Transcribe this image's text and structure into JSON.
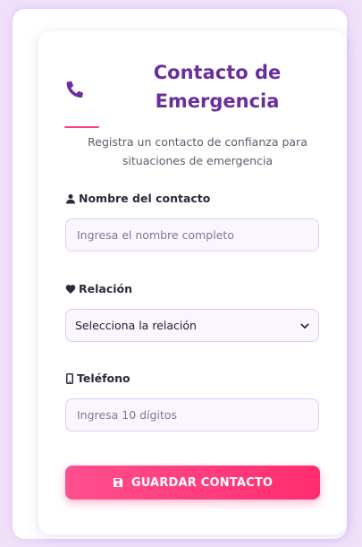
{
  "header": {
    "icon": "phone-icon",
    "title_line1": "Contacto de",
    "title_line2": "Emergencia",
    "subtitle_line1": "Registra un contacto de confianza para",
    "subtitle_line2": "situaciones de emergencia"
  },
  "form": {
    "name": {
      "icon": "user-icon",
      "label": "Nombre del contacto",
      "placeholder": "Ingresa el nombre completo"
    },
    "relation": {
      "icon": "heart-icon",
      "label": "Relación",
      "selected": "Selecciona la relación"
    },
    "phone": {
      "icon": "mobile-phone-icon",
      "label": "Teléfono",
      "placeholder": "Ingresa 10 dígitos"
    },
    "submit": {
      "icon": "floppy-disk-icon",
      "label": "GUARDAR CONTACTO"
    }
  },
  "colors": {
    "title": "#6a2f9c",
    "accent": "#ff3d7a",
    "button": "#ff3d7a",
    "background": "#f0e1fb"
  }
}
